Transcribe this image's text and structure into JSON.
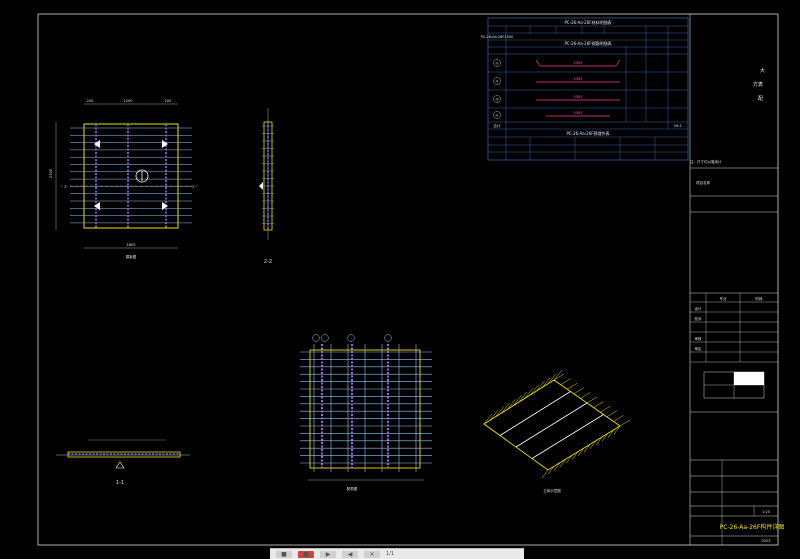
{
  "drawing": {
    "table_title_top": "PC-26-Aa-26F材料明细表",
    "table_title_mid": "PC-26-Aa-26F钢筋明细表",
    "table_title_low": "PC-26-Aa-26F预埋件表",
    "table_row_1": "PC-26-Aa-26F2500",
    "rebar_tags": [
      "①",
      "②",
      "③",
      "④"
    ],
    "rebar_lengths": [
      "2305",
      "2305",
      "2305",
      "2305"
    ],
    "sum_label": "合计",
    "sum_value": "26.1",
    "right_chars": [
      "大",
      "方表",
      "配"
    ],
    "project_name": "项目名称",
    "note_line": "注：尺寸均以毫米计",
    "tb_labels": [
      "专业",
      "阶段",
      "设计",
      "校对",
      "审核",
      "审定"
    ],
    "scale": "1:25",
    "drawing_no": "PC-26-Aa-26F构件详图",
    "date": "2023",
    "view_labels": [
      "模板图",
      "2-2",
      "1-1",
      "配筋图",
      "立体示意图"
    ],
    "dims_top": [
      "200",
      "1200",
      "200"
    ],
    "dims_side": "2300",
    "dims_bottom": "1600"
  },
  "toolbar": {
    "btn_icons": [
      "■",
      "■",
      "▶",
      "◀",
      "✕"
    ],
    "page": "1/1"
  },
  "colors": {
    "background": "#000000",
    "frame": "#d8d8d8",
    "rebar": "#8ec8ff",
    "edge": "#f0e000",
    "strand": "#9966dd",
    "table": "#3a7fd0",
    "pink": "#ff3aa0"
  }
}
